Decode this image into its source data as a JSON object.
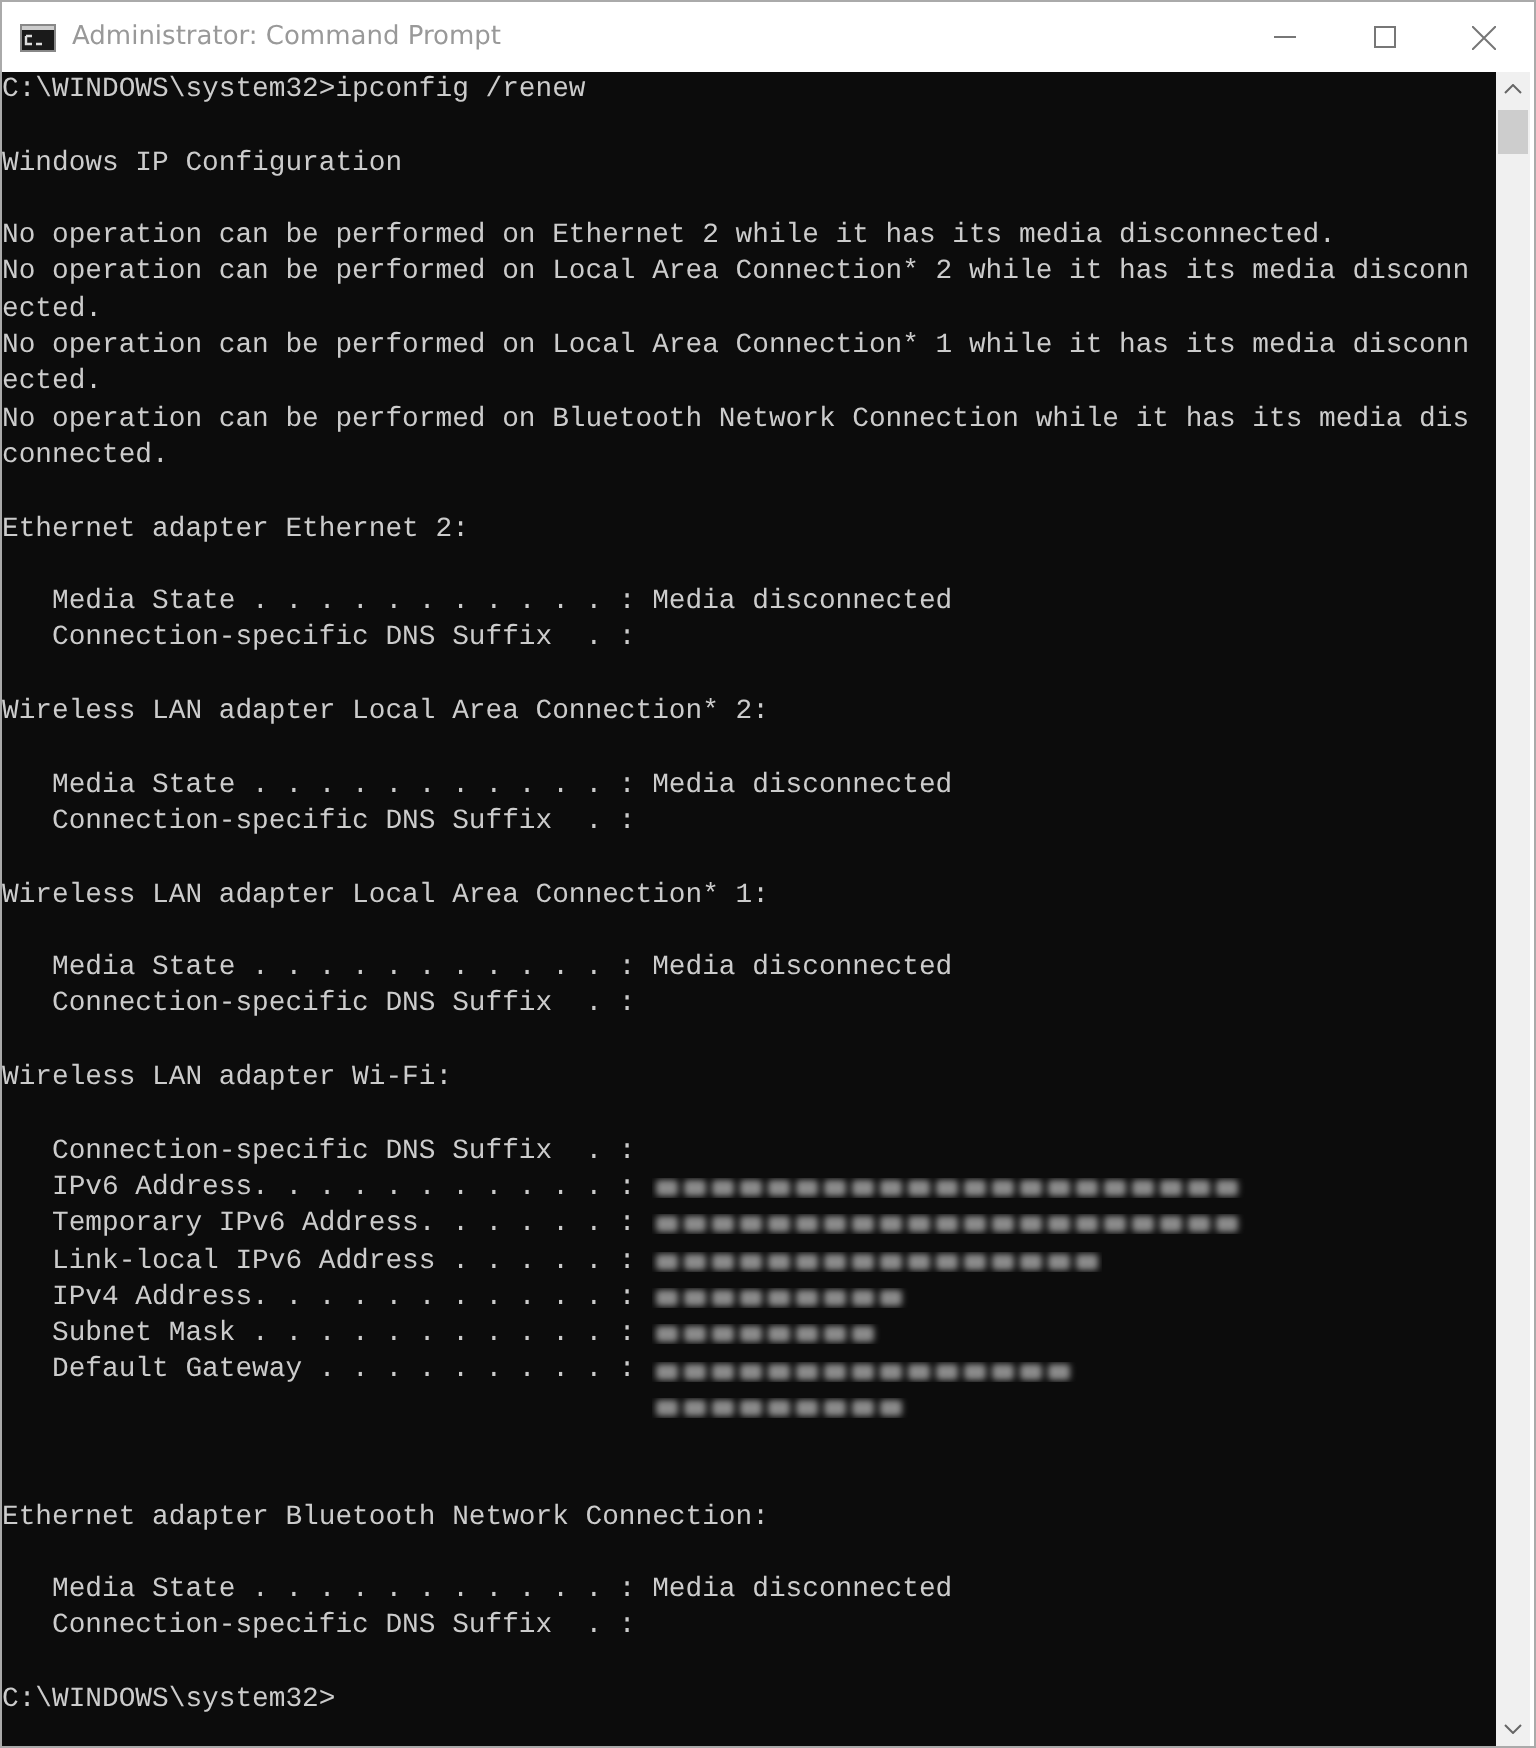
{
  "window": {
    "title": "Administrator: Command Prompt"
  },
  "console": {
    "lines": [
      {
        "kind": "text",
        "text": "C:\\WINDOWS\\system32>ipconfig /renew"
      },
      {
        "kind": "blank"
      },
      {
        "kind": "text",
        "text": "Windows IP Configuration"
      },
      {
        "kind": "blank"
      },
      {
        "kind": "text",
        "text": "No operation can be performed on Ethernet 2 while it has its media disconnected."
      },
      {
        "kind": "text",
        "text": "No operation can be performed on Local Area Connection* 2 while it has its media disconn"
      },
      {
        "kind": "text",
        "text": "ected."
      },
      {
        "kind": "text",
        "text": "No operation can be performed on Local Area Connection* 1 while it has its media disconn"
      },
      {
        "kind": "text",
        "text": "ected."
      },
      {
        "kind": "text",
        "text": "No operation can be performed on Bluetooth Network Connection while it has its media dis"
      },
      {
        "kind": "text",
        "text": "connected."
      },
      {
        "kind": "blank"
      },
      {
        "kind": "text",
        "text": "Ethernet adapter Ethernet 2:"
      },
      {
        "kind": "blank"
      },
      {
        "kind": "text",
        "text": "   Media State . . . . . . . . . . . : Media disconnected"
      },
      {
        "kind": "text",
        "text": "   Connection-specific DNS Suffix  . :"
      },
      {
        "kind": "blank"
      },
      {
        "kind": "text",
        "text": "Wireless LAN adapter Local Area Connection* 2:"
      },
      {
        "kind": "blank"
      },
      {
        "kind": "text",
        "text": "   Media State . . . . . . . . . . . : Media disconnected"
      },
      {
        "kind": "text",
        "text": "   Connection-specific DNS Suffix  . :"
      },
      {
        "kind": "blank"
      },
      {
        "kind": "text",
        "text": "Wireless LAN adapter Local Area Connection* 1:"
      },
      {
        "kind": "blank"
      },
      {
        "kind": "text",
        "text": "   Media State . . . . . . . . . . . : Media disconnected"
      },
      {
        "kind": "text",
        "text": "   Connection-specific DNS Suffix  . :"
      },
      {
        "kind": "blank"
      },
      {
        "kind": "text",
        "text": "Wireless LAN adapter Wi-Fi:"
      },
      {
        "kind": "blank"
      },
      {
        "kind": "text",
        "text": "   Connection-specific DNS Suffix  . :"
      },
      {
        "kind": "redacted",
        "text": "   IPv6 Address. . . . . . . . . . . :"
      },
      {
        "kind": "redacted",
        "text": "   Temporary IPv6 Address. . . . . . :"
      },
      {
        "kind": "redacted",
        "text": "   Link-local IPv6 Address . . . . . :"
      },
      {
        "kind": "redacted",
        "text": "   IPv4 Address. . . . . . . . . . . :"
      },
      {
        "kind": "redacted",
        "text": "   Subnet Mask . . . . . . . . . . . :"
      },
      {
        "kind": "redacted",
        "text": "   Default Gateway . . . . . . . . . :"
      },
      {
        "kind": "redacted_only"
      },
      {
        "kind": "blank"
      },
      {
        "kind": "blank"
      },
      {
        "kind": "text",
        "text": "Ethernet adapter Bluetooth Network Connection:"
      },
      {
        "kind": "blank"
      },
      {
        "kind": "text",
        "text": "   Media State . . . . . . . . . . . : Media disconnected"
      },
      {
        "kind": "text",
        "text": "   Connection-specific DNS Suffix  . :"
      },
      {
        "kind": "blank"
      },
      {
        "kind": "text",
        "text": "C:\\WINDOWS\\system32>"
      }
    ]
  }
}
